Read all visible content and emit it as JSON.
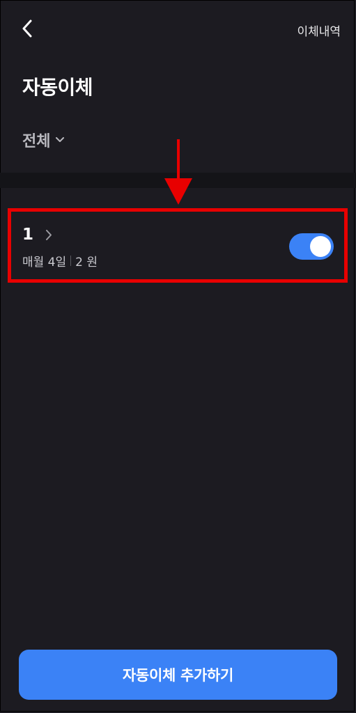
{
  "header": {
    "back_icon": "chevron-left-icon",
    "history_link": "이체내역"
  },
  "page": {
    "title": "자동이체"
  },
  "filter": {
    "label": "전체",
    "icon": "chevron-down-icon"
  },
  "transfers": [
    {
      "name": "1",
      "schedule": "매월 4일",
      "amount": "2 원",
      "enabled": true
    }
  ],
  "annotation": {
    "color": "#e80000"
  },
  "footer": {
    "add_button_label": "자동이체 추가하기"
  },
  "colors": {
    "background": "#1c1b21",
    "accent": "#3b82f6"
  }
}
